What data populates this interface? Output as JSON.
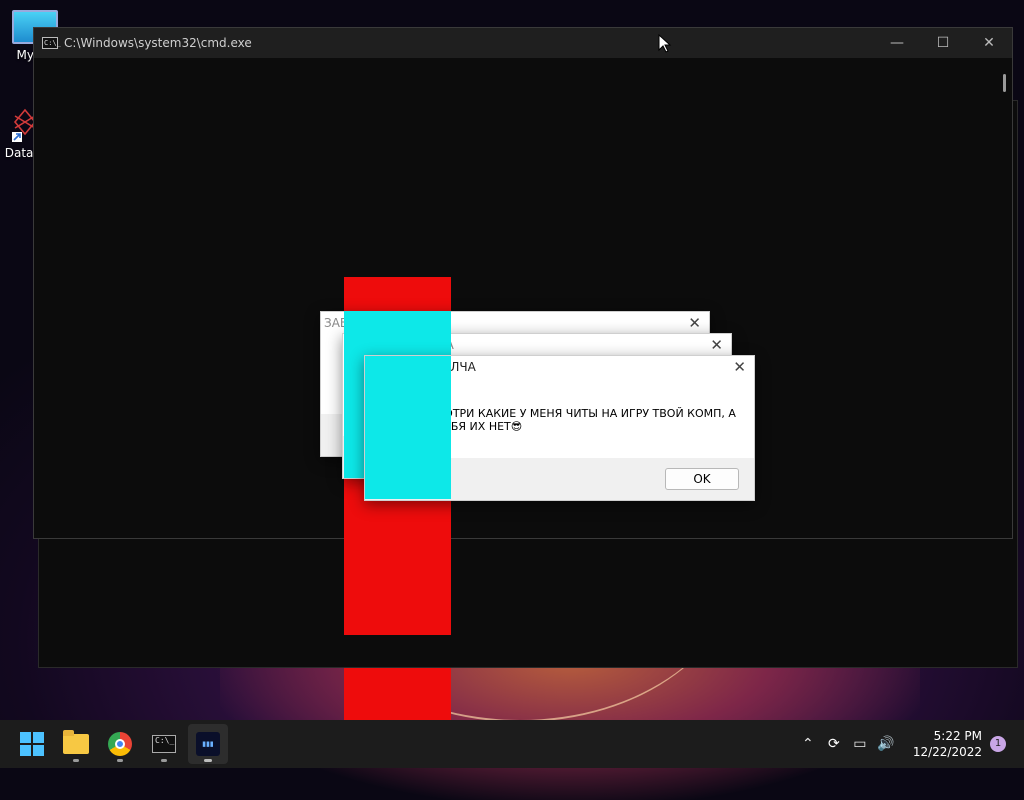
{
  "desktop": {
    "icons": [
      {
        "label": "My Co",
        "icon": "computer-icon"
      },
      {
        "label": "DataW",
        "icon": "datawatch-icon"
      }
    ]
  },
  "cmd_window": {
    "title": "C:\\Windows\\system32\\cmd.exe",
    "icon_text": "C:\\_",
    "minimize": "—",
    "maximize": "☐",
    "close": "✕"
  },
  "dialogs": [
    {
      "title": "ЗАВИДУЙ МОЛЧА",
      "close": "✕"
    },
    {
      "title": "ЗАВИДУЙ МОЛЧА",
      "close": "✕"
    },
    {
      "title": "ЗАВИДУЙ МОЛЧА",
      "close": "✕",
      "icon": "error-icon",
      "icon_glyph": "✕",
      "message": "СМОТРИ КАКИЕ У МЕНЯ ЧИТЫ НА ИГРУ ТВОЙ КОМП, А У ТЕБЯ ИХ НЕТ😎",
      "ok_label": "OK"
    }
  ],
  "taskbar": {
    "apps": [
      {
        "name": "start",
        "icon": "windows-start-icon"
      },
      {
        "name": "file-explorer",
        "icon": "folder-icon"
      },
      {
        "name": "chrome",
        "icon": "chrome-icon"
      },
      {
        "name": "cmd",
        "icon": "cmd-icon",
        "text": "C:\\_"
      },
      {
        "name": "terminal",
        "icon": "terminal-icon",
        "text": "▮▮▮"
      }
    ],
    "tray": {
      "chevron": "⌃",
      "sync": "⟳",
      "network": "▭",
      "volume": "🔊",
      "time": "5:22 PM",
      "date": "12/22/2022",
      "notification_count": "1"
    }
  },
  "colors": {
    "accent_red": "#ee0c0c",
    "accent_cyan": "#0de8e8",
    "error_green": "#1e6b37",
    "cmd_bg": "#0c0c0c"
  }
}
